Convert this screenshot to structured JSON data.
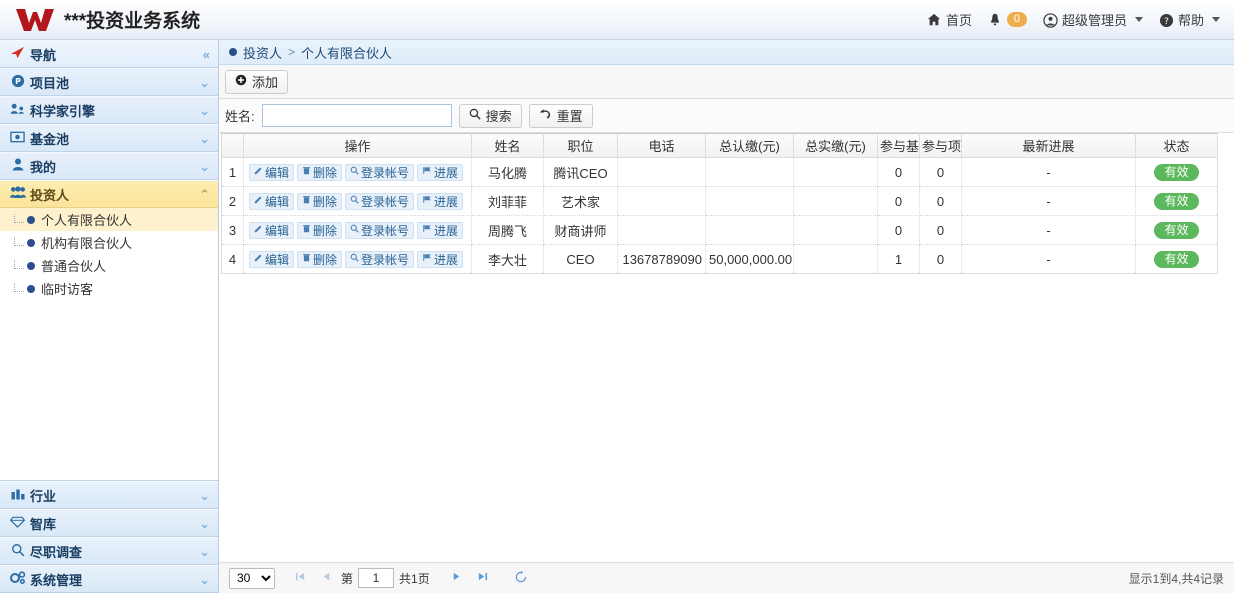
{
  "header": {
    "brand_title": "***投资业务系统",
    "logo_icon": "w-logo-icon",
    "nav": [
      {
        "icon": "home-icon",
        "label": "首页"
      },
      {
        "icon": "bell-icon",
        "label": "",
        "badge": "0"
      },
      {
        "icon": "user-circle-icon",
        "label": "超级管理员",
        "caret": true
      },
      {
        "icon": "help-circle-icon",
        "label": "帮助",
        "caret": true
      }
    ]
  },
  "sidebar": {
    "groups": [
      {
        "icon": "navigation-arrow-icon",
        "label": "导航",
        "chevron": "«",
        "state": "first"
      },
      {
        "icon": "project-pool-icon",
        "label": "项目池",
        "chevron": "⌄",
        "state": "collapsed"
      },
      {
        "icon": "scientist-engine-icon",
        "label": "科学家引擎",
        "chevron": "⌄",
        "state": "collapsed"
      },
      {
        "icon": "fund-pool-icon",
        "label": "基金池",
        "chevron": "⌄",
        "state": "collapsed"
      },
      {
        "icon": "person-icon",
        "label": "我的",
        "chevron": "⌄",
        "state": "collapsed"
      },
      {
        "icon": "investors-icon",
        "label": "投资人",
        "chevron": "⌃",
        "state": "active"
      }
    ],
    "sub_items": [
      {
        "label": "个人有限合伙人",
        "selected": true
      },
      {
        "label": "机构有限合伙人",
        "selected": false
      },
      {
        "label": "普通合伙人",
        "selected": false
      },
      {
        "label": "临时访客",
        "selected": false
      }
    ],
    "bottom_groups": [
      {
        "icon": "industry-chart-icon",
        "label": "行业",
        "chevron": "⌄"
      },
      {
        "icon": "think-tank-diamond-icon",
        "label": "智库",
        "chevron": "⌄"
      },
      {
        "icon": "due-diligence-search-icon",
        "label": "尽职调查",
        "chevron": "⌄"
      },
      {
        "icon": "system-settings-gears-icon",
        "label": "系统管理",
        "chevron": "⌄"
      }
    ]
  },
  "breadcrumb": {
    "root": "投资人",
    "separator": ">",
    "current": "个人有限合伙人"
  },
  "toolbar": {
    "add_label": "添加",
    "add_icon": "plus-circle-icon"
  },
  "filter": {
    "name_label": "姓名:",
    "name_value": "",
    "name_placeholder": "",
    "search_label": "搜索",
    "search_icon": "search-icon",
    "reset_label": "重置",
    "reset_icon": "undo-arrow-icon"
  },
  "table": {
    "columns": [
      "",
      "操作",
      "姓名",
      "职位",
      "电话",
      "总认缴(元)",
      "总实缴(元)",
      "参与基",
      "参与项",
      "最新进展",
      "状态"
    ],
    "row_actions": [
      {
        "label": "编辑",
        "icon": "edit-pencil-icon"
      },
      {
        "label": "删除",
        "icon": "trash-icon"
      },
      {
        "label": "登录帐号",
        "icon": "key-search-icon"
      },
      {
        "label": "进展",
        "icon": "flag-icon"
      }
    ],
    "rows": [
      {
        "idx": "1",
        "name": "马化腾",
        "position": "腾讯CEO",
        "phone": "",
        "subscribed": "",
        "paid": "",
        "funds": "0",
        "projects": "0",
        "progress": "-",
        "status": "有效"
      },
      {
        "idx": "2",
        "name": "刘菲菲",
        "position": "艺术家",
        "phone": "",
        "subscribed": "",
        "paid": "",
        "funds": "0",
        "projects": "0",
        "progress": "-",
        "status": "有效"
      },
      {
        "idx": "3",
        "name": "周腾飞",
        "position": "财商讲师",
        "phone": "",
        "subscribed": "",
        "paid": "",
        "funds": "0",
        "projects": "0",
        "progress": "-",
        "status": "有效"
      },
      {
        "idx": "4",
        "name": "李大壮",
        "position": "CEO",
        "phone": "13678789090",
        "subscribed": "50,000,000.00",
        "paid": "",
        "funds": "1",
        "projects": "0",
        "progress": "-",
        "status": "有效"
      }
    ]
  },
  "pagination": {
    "page_size": "30",
    "page_size_options": [
      "30"
    ],
    "first_icon": "first-page-icon",
    "prev_icon": "prev-page-icon",
    "next_icon": "next-page-icon",
    "last_icon": "last-page-icon",
    "refresh_icon": "refresh-icon",
    "page_prefix": "第",
    "page_value": "1",
    "page_total": "共1页",
    "summary": "显示1到4,共4记录"
  },
  "colors": {
    "brand_red": "#b3161b",
    "accent_blue": "#2a6496",
    "status_green": "#5cb85c",
    "badge_orange": "#f0ad4e",
    "active_yellow": "#fbe39a"
  }
}
